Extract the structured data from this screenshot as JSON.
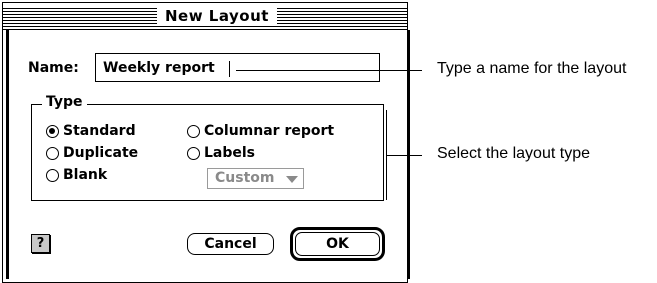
{
  "dialog": {
    "title": "New Layout",
    "name_label": "Name:",
    "name_value": "Weekly report",
    "type_group_title": "Type",
    "options": [
      {
        "label": "Standard",
        "selected": true
      },
      {
        "label": "Duplicate",
        "selected": false
      },
      {
        "label": "Blank",
        "selected": false
      },
      {
        "label": "Columnar report",
        "selected": false
      },
      {
        "label": "Labels",
        "selected": false
      }
    ],
    "labels_popup_value": "Custom",
    "help_label": "?",
    "cancel_label": "Cancel",
    "ok_label": "OK"
  },
  "callouts": {
    "name": "Type a name for the layout",
    "type": "Select the layout type"
  }
}
